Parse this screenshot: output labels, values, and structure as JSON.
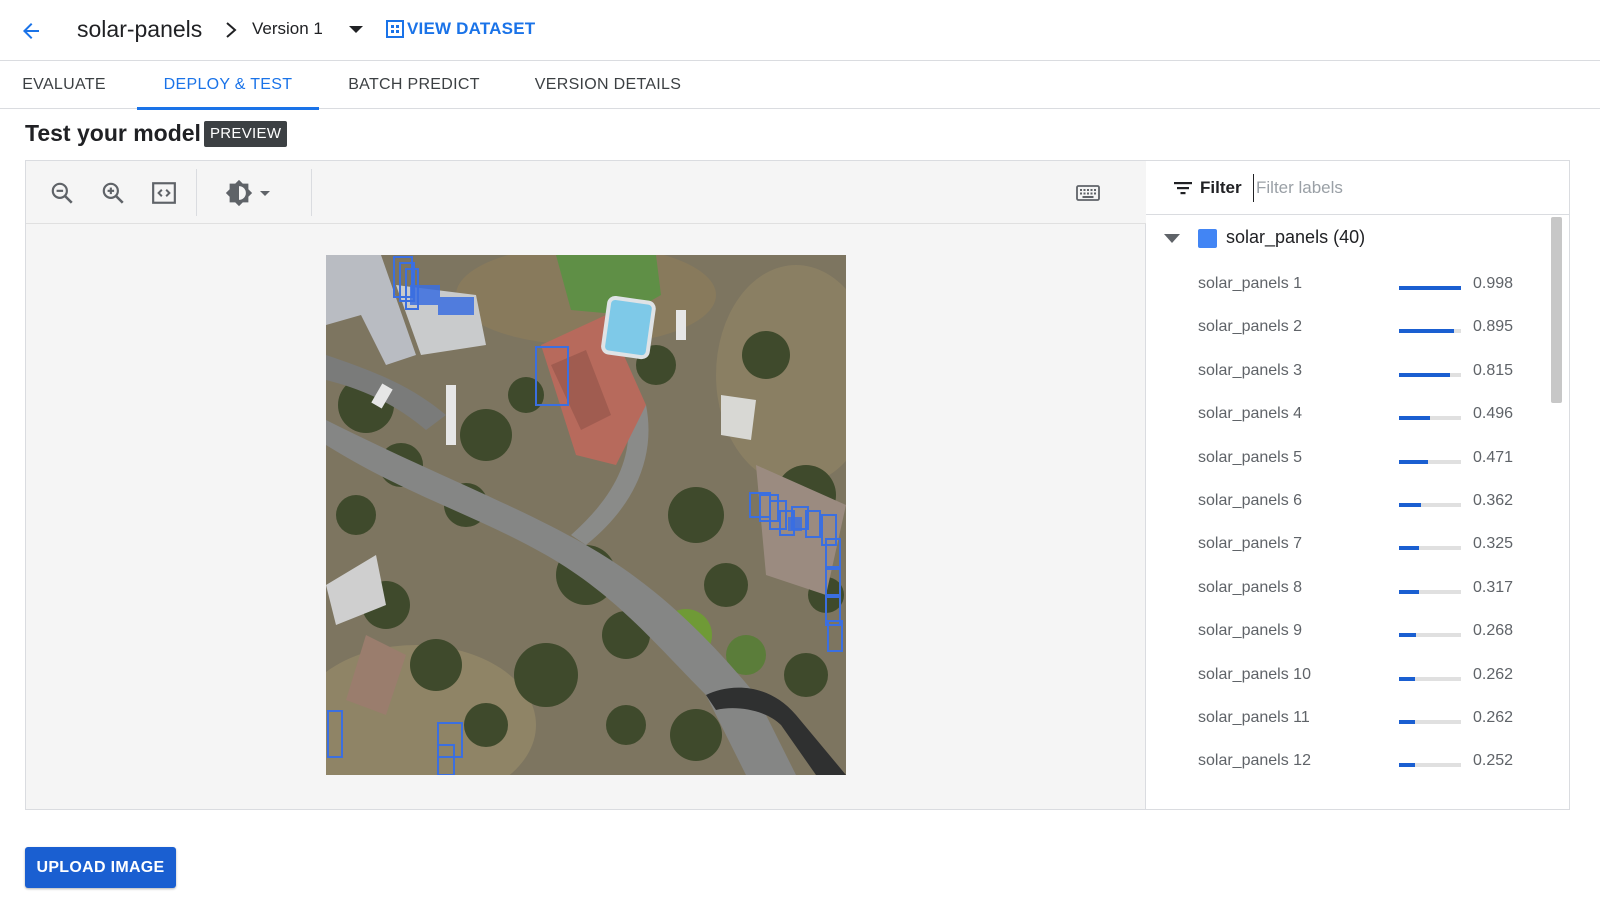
{
  "header": {
    "back_icon": "arrow-back-icon",
    "model_name": "solar-panels",
    "version": "Version 1",
    "view_dataset_label": "VIEW DATASET"
  },
  "tabs": [
    {
      "label": "EVALUATE",
      "active": false
    },
    {
      "label": "DEPLOY & TEST",
      "active": true
    },
    {
      "label": "BATCH PREDICT",
      "active": false
    },
    {
      "label": "VERSION DETAILS",
      "active": false
    }
  ],
  "section": {
    "title": "Test your model",
    "badge": "PREVIEW"
  },
  "toolbar": {
    "icons": [
      "zoom-out-icon",
      "zoom-in-icon",
      "fit-to-screen-icon",
      "brightness-icon",
      "keyboard-icon"
    ]
  },
  "filter": {
    "label": "Filter",
    "placeholder": "Filter labels"
  },
  "label_group": {
    "label": "solar_panels (40)",
    "color": "#4285f4"
  },
  "labels": [
    {
      "name": "solar_panels 1",
      "score": "0.998"
    },
    {
      "name": "solar_panels 2",
      "score": "0.895"
    },
    {
      "name": "solar_panels 3",
      "score": "0.815"
    },
    {
      "name": "solar_panels 4",
      "score": "0.496"
    },
    {
      "name": "solar_panels 5",
      "score": "0.471"
    },
    {
      "name": "solar_panels 6",
      "score": "0.362"
    },
    {
      "name": "solar_panels 7",
      "score": "0.325"
    },
    {
      "name": "solar_panels 8",
      "score": "0.317"
    },
    {
      "name": "solar_panels 9",
      "score": "0.268"
    },
    {
      "name": "solar_panels 10",
      "score": "0.262"
    },
    {
      "name": "solar_panels 11",
      "score": "0.262"
    },
    {
      "name": "solar_panels 12",
      "score": "0.252"
    }
  ],
  "upload_label": "UPLOAD IMAGE",
  "colors": {
    "accent": "#1a73e8",
    "score_bar": "#1a5fd1",
    "box": "#3b6fe0"
  }
}
